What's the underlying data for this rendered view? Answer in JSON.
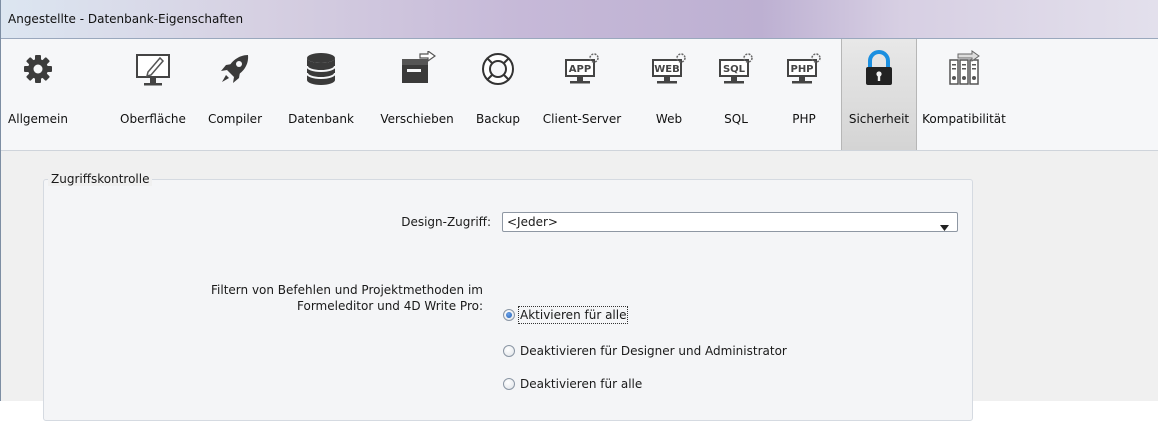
{
  "window": {
    "title": "Angestellte - Datenbank-Eigenschaften"
  },
  "toolbar": {
    "items": [
      {
        "label": "Allgemein",
        "icon": "gear-icon"
      },
      {
        "label": "Oberfläche",
        "icon": "monitor-pen-icon"
      },
      {
        "label": "Compiler",
        "icon": "rocket-icon"
      },
      {
        "label": "Datenbank",
        "icon": "database-icon"
      },
      {
        "label": "Verschieben",
        "icon": "move-box-icon"
      },
      {
        "label": "Backup",
        "icon": "lifebuoy-icon"
      },
      {
        "label": "Client-Server",
        "icon": "app-server-icon"
      },
      {
        "label": "Web",
        "icon": "web-server-icon"
      },
      {
        "label": "SQL",
        "icon": "sql-server-icon"
      },
      {
        "label": "PHP",
        "icon": "php-server-icon"
      },
      {
        "label": "Sicherheit",
        "icon": "padlock-icon"
      },
      {
        "label": "Kompatibilität",
        "icon": "compatibility-icon"
      }
    ],
    "active": "Sicherheit"
  },
  "panel": {
    "group_title": "Zugriffskontrolle",
    "design_access": {
      "label": "Design-Zugriff:",
      "value": "<Jeder>"
    },
    "filter": {
      "label_line1": "Filtern von Befehlen und Projektmethoden im",
      "label_line2": "Formeleditor und 4D Write Pro:",
      "options": [
        {
          "label": "Aktivieren für alle",
          "checked": true
        },
        {
          "label": "Deaktivieren für Designer und Administrator",
          "checked": false
        },
        {
          "label": "Deaktivieren für alle",
          "checked": false
        }
      ]
    }
  },
  "colors": {
    "accent": "#1f5fb8",
    "lock": "#1b8fe0",
    "title_bar": "#c6b9d8"
  }
}
